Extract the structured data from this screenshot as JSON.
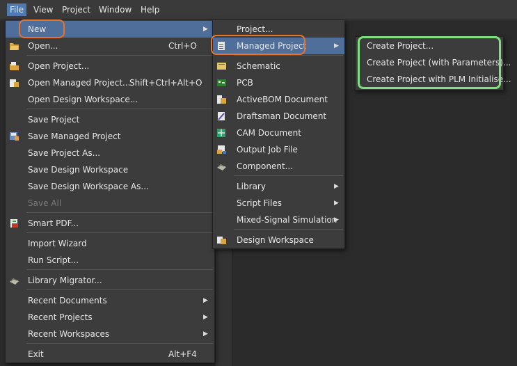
{
  "menubar": {
    "items": [
      {
        "label": "File"
      },
      {
        "label": "View"
      },
      {
        "label": "Project"
      },
      {
        "label": "Window"
      },
      {
        "label": "Help"
      }
    ]
  },
  "file_menu": {
    "new": "New",
    "open": "Open...",
    "open_sc": "Ctrl+O",
    "open_project": "Open Project...",
    "open_managed": "Open Managed Project...",
    "open_managed_sc": "Shift+Ctrl+Alt+O",
    "open_workspace": "Open Design Workspace...",
    "save_project": "Save Project",
    "save_managed": "Save Managed Project",
    "save_project_as": "Save Project As...",
    "save_workspace": "Save Design Workspace",
    "save_workspace_as": "Save Design Workspace As...",
    "save_all": "Save All",
    "smart_pdf": "Smart PDF...",
    "import_wizard": "Import Wizard",
    "run_script": "Run Script...",
    "library_migrator": "Library Migrator...",
    "recent_documents": "Recent Documents",
    "recent_projects": "Recent Projects",
    "recent_workspaces": "Recent Workspaces",
    "exit": "Exit",
    "exit_sc": "Alt+F4"
  },
  "new_menu": {
    "project": "Project...",
    "managed_project": "Managed Project",
    "schematic": "Schematic",
    "pcb": "PCB",
    "activebom": "ActiveBOM Document",
    "draftsman": "Draftsman Document",
    "cam": "CAM Document",
    "output_job": "Output Job File",
    "component": "Component...",
    "library": "Library",
    "script_files": "Script Files",
    "mixed_signal": "Mixed-Signal Simulation",
    "design_workspace": "Design Workspace"
  },
  "managed_menu": {
    "create_project": "Create Project...",
    "create_project_params": "Create Project (with Parameters)...",
    "create_project_plm": "Create Project with PLM Initialise..."
  },
  "colors": {
    "highlight_orange": "#e8742a",
    "highlight_green": "#7fe07f",
    "selection": "#4f6f9a"
  }
}
